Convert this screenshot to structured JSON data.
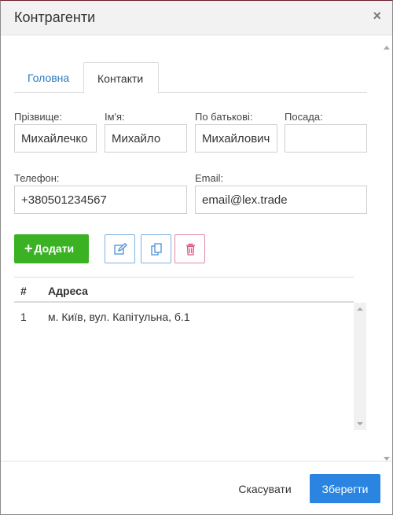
{
  "dialog": {
    "title": "Контрагенти"
  },
  "tabs": [
    {
      "label": "Головна",
      "active": false
    },
    {
      "label": "Контакти",
      "active": true
    }
  ],
  "form": {
    "surname": {
      "label": "Прізвище:",
      "value": "Михайлечко"
    },
    "name": {
      "label": "Ім'я:",
      "value": "Михайло"
    },
    "patronymic": {
      "label": "По батькові:",
      "value": "Михайлович"
    },
    "position": {
      "label": "Посада:",
      "value": ""
    },
    "phone": {
      "label": "Телефон:",
      "value": "+380501234567"
    },
    "email": {
      "label": "Email:",
      "value": "email@lex.trade"
    }
  },
  "toolbar": {
    "add_label": "Додати",
    "add_icon": "plus-icon",
    "edit_icon": "pencil-icon",
    "copy_icon": "copy-icon",
    "delete_icon": "trash-icon"
  },
  "table": {
    "columns": [
      "#",
      "Адреса"
    ],
    "rows": [
      {
        "num": "1",
        "address": "м. Київ, вул. Капітульна, б.1"
      }
    ]
  },
  "footer": {
    "cancel_label": "Скасувати",
    "save_label": "Зберегти"
  },
  "colors": {
    "add_button": "#3bb224",
    "save_button": "#2a84e0",
    "tab_link": "#2a7ac6",
    "delete_border": "#e08aa4",
    "edit_border": "#7fb2e0"
  }
}
